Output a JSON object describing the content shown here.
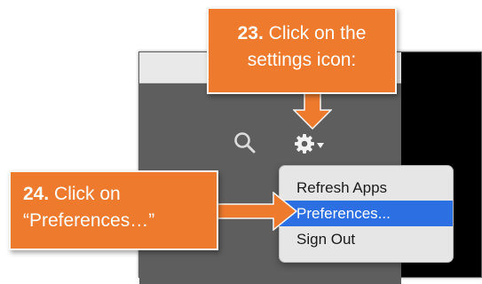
{
  "callouts": {
    "step23": {
      "number": "23.",
      "text": "Click on the settings icon:"
    },
    "step24": {
      "number": "24.",
      "text": "Click on “Preferences…”"
    }
  },
  "toolbar": {
    "search_icon": "search-icon",
    "settings_icon": "gear-icon"
  },
  "menu": {
    "items": [
      {
        "label": "Refresh Apps",
        "selected": false
      },
      {
        "label": "Preferences...",
        "selected": true
      },
      {
        "label": "Sign Out",
        "selected": false
      }
    ]
  },
  "colors": {
    "callout": "#ee7a2d",
    "highlight": "#2b6fe3",
    "toolbar": "#5e5e5f",
    "menu_bg": "#e6e6e6"
  }
}
